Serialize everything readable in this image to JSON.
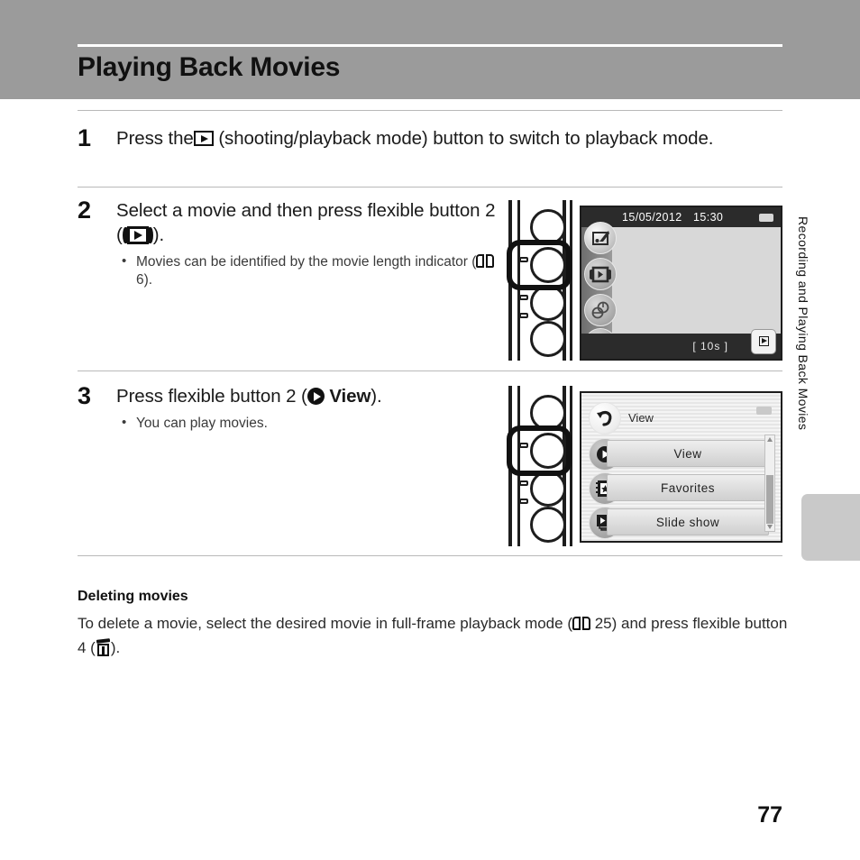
{
  "header": {
    "title": "Playing Back Movies"
  },
  "steps": [
    {
      "number": "1",
      "text_before": "Press the",
      "icon": "play-box-icon",
      "text_after": "(shooting/playback mode) button to switch to playback mode.",
      "bullets": []
    },
    {
      "number": "2",
      "text_before": "Select a movie and then press flexible button 2 (",
      "icon": "movie-film-icon",
      "text_after": ").",
      "bullets": [
        {
          "text_before": "Movies can be identified by the movie length indicator (",
          "icon": "book-reference-icon",
          "page_ref": "6",
          "text_after": ")."
        }
      ]
    },
    {
      "number": "3",
      "text_before": "Press flexible button 2 (",
      "icon": "play-circle-icon",
      "bold_label": "View",
      "text_after": ").",
      "bullets": [
        {
          "text_before": "You can play movies.",
          "icon": "",
          "page_ref": "",
          "text_after": ""
        }
      ]
    }
  ],
  "camera_screen_playback": {
    "date": "15/05/2012",
    "time": "15:30",
    "battery": "battery-icon",
    "movie_length_indicator": "[        10s ]",
    "flexible_buttons": [
      "retouch-icon",
      "movie-playback-icon",
      "effects-icon",
      "delete-trash-icon"
    ],
    "playback_tag": "playback-mode-icon"
  },
  "camera_screen_menu": {
    "header_label": "View",
    "header_icon": "back-arrow-icon",
    "battery": "battery-icon",
    "rows": [
      {
        "label": "View",
        "icon": "play-circle-icon"
      },
      {
        "label": "Favorites",
        "icon": "favorites-album-icon"
      },
      {
        "label": "Slide show",
        "icon": "slide-show-icon"
      }
    ],
    "scrollbar": "menu-scrollbar"
  },
  "camera_illustration": {
    "buttons_count": "4",
    "highlighted_button": "2"
  },
  "note": {
    "title": "Deleting movies",
    "text_part1": "To delete a movie, select the desired movie in full-frame playback mode (",
    "book_icon": "book-reference-icon",
    "page_ref": "25",
    "text_part2": ") and press flexible button 4 (",
    "trash_icon": "delete-trash-icon",
    "text_part3": ")."
  },
  "side_tab": {
    "label": "Recording and Playing Back Movies"
  },
  "footer": {
    "page_number": "77"
  },
  "colors": {
    "header_band": "#9b9b9b",
    "side_tab": "#c9c9c9",
    "divider": "#b9b9b9",
    "lcd_bg": "#d8d8d8"
  }
}
